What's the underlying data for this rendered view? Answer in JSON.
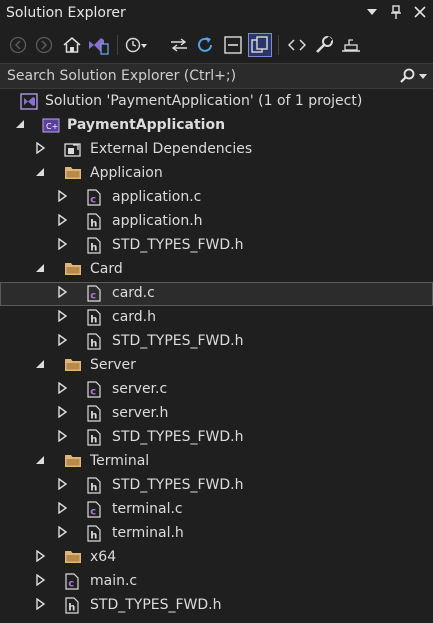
{
  "window": {
    "title": "Solution Explorer"
  },
  "search": {
    "placeholder": "Search Solution Explorer (Ctrl+;)"
  },
  "tree": {
    "solution": "Solution 'PaymentApplication' (1 of 1 project)",
    "project": "PaymentApplication",
    "external": "External Dependencies",
    "folder_app": "Applicaion",
    "app_c": "application.c",
    "app_h": "application.h",
    "app_std": "STD_TYPES_FWD.h",
    "folder_card": "Card",
    "card_c": "card.c",
    "card_h": "card.h",
    "card_std": "STD_TYPES_FWD.h",
    "folder_server": "Server",
    "server_c": "server.c",
    "server_h": "server.h",
    "server_std": "STD_TYPES_FWD.h",
    "folder_terminal": "Terminal",
    "term_std": "STD_TYPES_FWD.h",
    "term_c": "terminal.c",
    "term_h": "terminal.h",
    "folder_x64": "x64",
    "main_c": "main.c",
    "root_std": "STD_TYPES_FWD.h"
  },
  "colors": {
    "background": "#1f1f1f",
    "folder": "#dcb67a",
    "c_file": "#a07ed6",
    "accent": "#7c8bd8",
    "selection_border": "#5a5a5a"
  }
}
